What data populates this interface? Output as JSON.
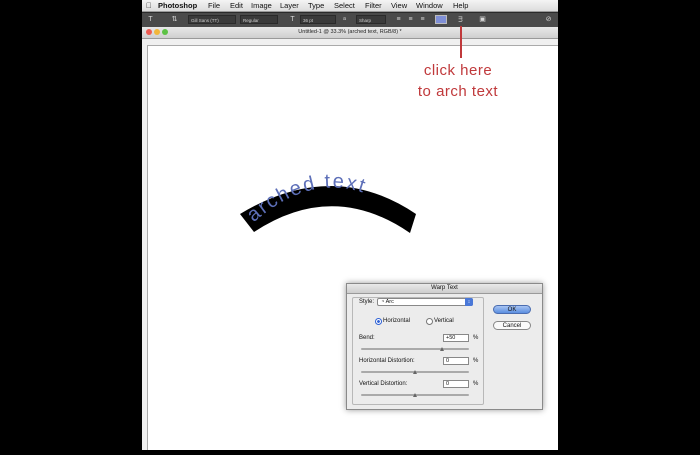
{
  "menubar": {
    "app_name": "Photoshop",
    "items": [
      "File",
      "Edit",
      "Image",
      "Layer",
      "Type",
      "Select",
      "Filter",
      "View",
      "Window",
      "Help"
    ]
  },
  "options_bar": {
    "font_family": "Gill Sans (TT)",
    "font_style": "Regular",
    "font_size": "36 pt",
    "anti_alias": "Sharp",
    "text_color": "#7f8fd6"
  },
  "document": {
    "title": "Untitled-1 @ 33.3% (arched text, RGB/8) *"
  },
  "canvas": {
    "text": "arched text",
    "text_color": "#5d6fb8",
    "shape_color": "#000000"
  },
  "annotation": {
    "line1": "click here",
    "line2": "to arch text",
    "color": "#c0393b"
  },
  "dialog": {
    "title": "Warp Text",
    "style_label": "Style:",
    "style_value": "Arc",
    "orientation_options": [
      "Horizontal",
      "Vertical"
    ],
    "orientation_selected": "Horizontal",
    "bend_label": "Bend:",
    "bend_value": "+50",
    "bend_percent": 50,
    "h_distortion_label": "Horizontal Distortion:",
    "h_distortion_value": "0",
    "h_distortion_percent": 0,
    "v_distortion_label": "Vertical Distortion:",
    "v_distortion_value": "0",
    "v_distortion_percent": 0,
    "percent_sign": "%",
    "ok_label": "OK",
    "cancel_label": "Cancel"
  }
}
